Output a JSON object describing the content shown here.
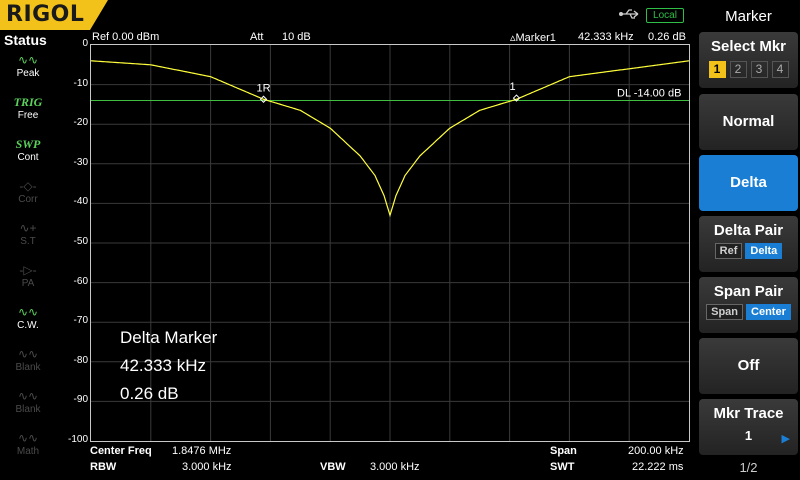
{
  "brand": {
    "logo": "RIGOL"
  },
  "topbar": {
    "usb_icon": "usb-icon",
    "remote_status": "Local"
  },
  "status": {
    "title": "Status",
    "items": [
      {
        "glyph": "∿∿",
        "label": "Peak",
        "state": "active"
      },
      {
        "glyph": "TRIG",
        "label": "Free",
        "state": "active"
      },
      {
        "glyph": "SWP",
        "label": "Cont",
        "state": "active"
      },
      {
        "glyph": "-◇-",
        "label": "Corr",
        "state": "dim"
      },
      {
        "glyph": "∿+",
        "label": "S.T",
        "state": "dim"
      },
      {
        "glyph": "-▷-",
        "label": "PA",
        "state": "dim"
      },
      {
        "glyph": "∿∿",
        "label": "C.W.",
        "state": "active"
      },
      {
        "glyph": "∿∿",
        "label": "Blank",
        "state": "dim"
      },
      {
        "glyph": "∿∿",
        "label": "Blank",
        "state": "dim"
      },
      {
        "glyph": "∿∿",
        "label": "Math",
        "state": "dim"
      }
    ]
  },
  "plot_header": {
    "ref": "Ref  0.00 dBm",
    "att_label": "Att",
    "att_value": "10 dB",
    "marker_label": "▵Marker1",
    "marker_freq": "42.333 kHz",
    "marker_amp": "0.26 dB"
  },
  "display_line": "DL  -14.00 dB",
  "markers": {
    "ref_label": "1R",
    "delta_label": "1"
  },
  "delta_readout": {
    "title": "Delta Marker",
    "freq": "42.333 kHz",
    "amp": "0.26 dB"
  },
  "footer": {
    "center_freq_label": "Center Freq",
    "center_freq_value": "1.8476 MHz",
    "span_label": "Span",
    "span_value": "200.00 kHz",
    "rbw_label": "RBW",
    "rbw_value": "3.000 kHz",
    "vbw_label": "VBW",
    "vbw_value": "3.000 kHz",
    "swt_label": "SWT",
    "swt_value": "22.222 ms"
  },
  "menu": {
    "title": "Marker",
    "select_mkr": {
      "label": "Select Mkr",
      "options": [
        "1",
        "2",
        "3",
        "4"
      ],
      "selected": "1"
    },
    "normal": "Normal",
    "delta": "Delta",
    "delta_pair": {
      "label": "Delta Pair",
      "options": [
        "Ref",
        "Delta"
      ],
      "selected": "Delta"
    },
    "span_pair": {
      "label": "Span Pair",
      "options": [
        "Span",
        "Center"
      ],
      "selected": "Center"
    },
    "off": "Off",
    "mkr_trace": {
      "label": "Mkr Trace",
      "value": "1"
    },
    "page": "1/2"
  },
  "colors": {
    "trace": "#ffff3c",
    "display_line": "#3fbf3f",
    "accent": "#1a7fd4",
    "brand": "#f3c21a"
  },
  "chart_data": {
    "type": "line",
    "xlabel": "",
    "ylabel": "",
    "ylim": [
      -100,
      0
    ],
    "y_ticks": [
      "0",
      "-10",
      "-20",
      "-30",
      "-40",
      "-50",
      "-60",
      "-70",
      "-80",
      "-90",
      "-100"
    ],
    "x_range_khz": [
      -100,
      100
    ],
    "series": [
      {
        "x_khz": [
          -100,
          -80,
          -60,
          -42.3,
          -30,
          -20,
          -10,
          -5,
          -2,
          0,
          2,
          5,
          10,
          20,
          30,
          42.3,
          60,
          80,
          100
        ],
        "y_db": [
          -4,
          -5,
          -8,
          -13.7,
          -16.5,
          -21,
          -28,
          -33,
          -38,
          -43,
          -38,
          -33,
          -28,
          -21,
          -16.5,
          -13.7,
          -8,
          -6,
          -4
        ]
      }
    ],
    "display_line_db": -14.0,
    "markers": [
      {
        "label": "1R",
        "x_khz": -42.3,
        "y_db": -13.7
      },
      {
        "label": "1",
        "x_khz": 42.3,
        "y_db": -13.4
      }
    ]
  }
}
